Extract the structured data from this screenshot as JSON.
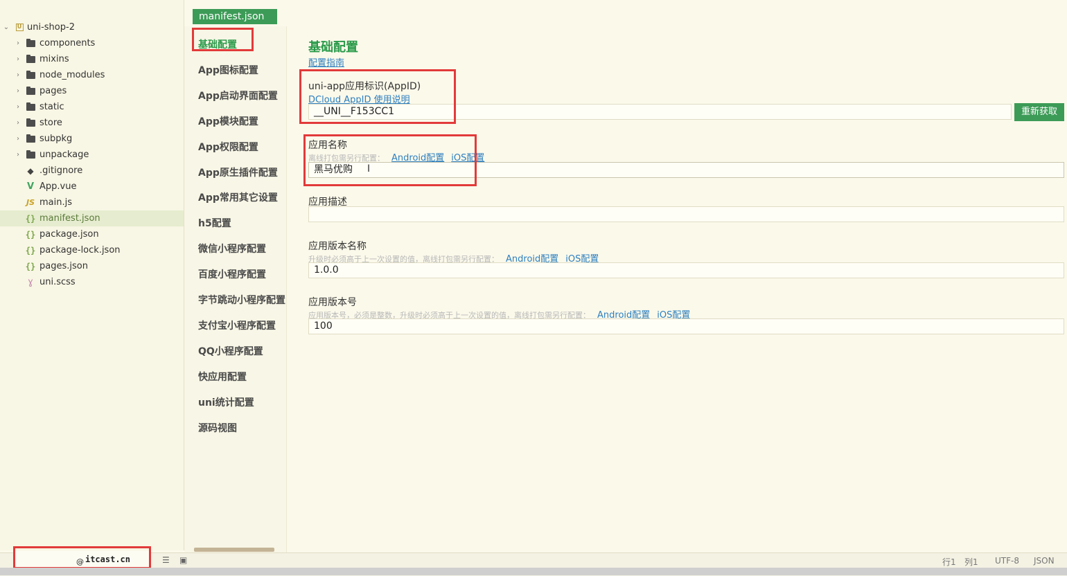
{
  "file_tree": {
    "project": "uni-shop-2",
    "items": [
      {
        "label": "components",
        "type": "folder"
      },
      {
        "label": "mixins",
        "type": "folder"
      },
      {
        "label": "node_modules",
        "type": "folder"
      },
      {
        "label": "pages",
        "type": "folder"
      },
      {
        "label": "static",
        "type": "folder"
      },
      {
        "label": "store",
        "type": "folder"
      },
      {
        "label": "subpkg",
        "type": "folder"
      },
      {
        "label": "unpackage",
        "type": "folder"
      },
      {
        "label": ".gitignore",
        "type": "git"
      },
      {
        "label": "App.vue",
        "type": "vue"
      },
      {
        "label": "main.js",
        "type": "js"
      },
      {
        "label": "manifest.json",
        "type": "json",
        "selected": true
      },
      {
        "label": "package.json",
        "type": "json"
      },
      {
        "label": "package-lock.json",
        "type": "json"
      },
      {
        "label": "pages.json",
        "type": "json"
      },
      {
        "label": "uni.scss",
        "type": "scss"
      }
    ],
    "icons": {
      "chevron": "›",
      "collapse": "⌄",
      "json": "{}",
      "js": "JS",
      "vue": "V",
      "git": "◆",
      "scss": "ɣ"
    }
  },
  "editor_tab": "manifest.json",
  "nav": {
    "items": [
      "基础配置",
      "App图标配置",
      "App启动界面配置",
      "App模块配置",
      "App权限配置",
      "App原生插件配置",
      "App常用其它设置",
      "h5配置",
      "微信小程序配置",
      "百度小程序配置",
      "字节跳动小程序配置",
      "支付宝小程序配置",
      "QQ小程序配置",
      "快应用配置",
      "uni统计配置",
      "源码视图"
    ],
    "active_index": 0
  },
  "form": {
    "title": "基础配置",
    "guide_link": "配置指南",
    "appid": {
      "label": "uni-app应用标识(AppID)",
      "help_link": "DCloud AppID 使用说明",
      "value": "__UNI__F153CC1",
      "refresh_button": "重新获取"
    },
    "app_name": {
      "label": "应用名称",
      "hint": "离线打包需另行配置：",
      "android_link": "Android配置",
      "ios_link": "iOS配置",
      "value": "黑马优购"
    },
    "app_desc": {
      "label": "应用描述",
      "value": ""
    },
    "version_name": {
      "label": "应用版本名称",
      "hint": "升级时必须高于上一次设置的值，离线打包需另行配置：",
      "android_link": "Android配置",
      "ios_link": "iOS配置",
      "value": "1.0.0"
    },
    "version_code": {
      "label": "应用版本号",
      "hint": "应用版本号，必须是整数，升级时必须高于上一次设置的值，离线打包需另行配置：",
      "android_link": "Android配置",
      "ios_link": "iOS配置",
      "value": "100"
    }
  },
  "status": {
    "brand": "itcast.cn",
    "encoding": "UTF-8",
    "language": "JSON",
    "line_label": "行1",
    "col_label": "列1"
  },
  "colors": {
    "accent": "#3c9b57",
    "highlight": "#e23a3a",
    "link": "#2d7fc0"
  }
}
